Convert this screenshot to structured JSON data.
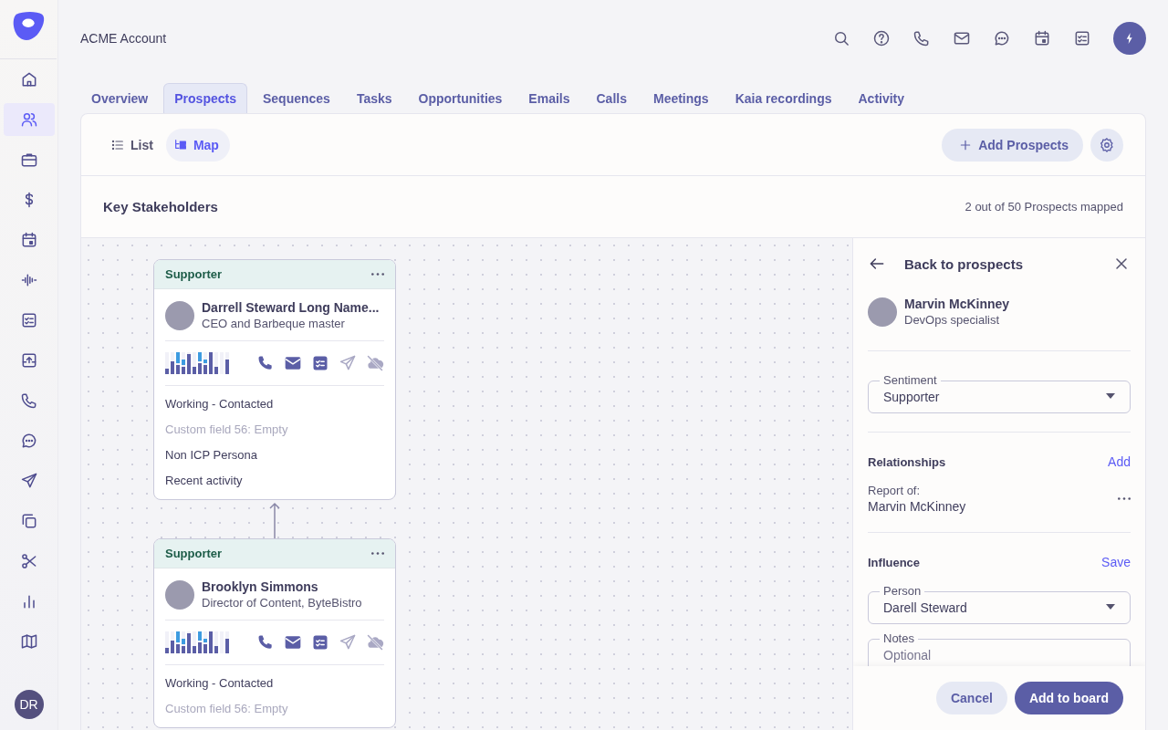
{
  "sidebar": {
    "items": [
      {
        "selected": false
      },
      {
        "selected": true
      },
      {
        "selected": false
      },
      {
        "selected": false
      },
      {
        "selected": false
      },
      {
        "selected": false
      },
      {
        "selected": false
      },
      {
        "selected": false
      },
      {
        "selected": false
      },
      {
        "selected": false
      },
      {
        "selected": false
      },
      {
        "selected": false
      },
      {
        "selected": false
      },
      {
        "selected": false
      },
      {
        "selected": false
      }
    ],
    "user_initials": "DR"
  },
  "header": {
    "title": "ACME Account"
  },
  "tabs": [
    {
      "label": "Overview",
      "selected": false
    },
    {
      "label": "Prospects",
      "selected": true
    },
    {
      "label": "Sequences",
      "selected": false
    },
    {
      "label": "Tasks",
      "selected": false
    },
    {
      "label": "Opportunities",
      "selected": false
    },
    {
      "label": "Emails",
      "selected": false
    },
    {
      "label": "Calls",
      "selected": false
    },
    {
      "label": "Meetings",
      "selected": false
    },
    {
      "label": "Kaia recordings",
      "selected": false
    },
    {
      "label": "Activity",
      "selected": false
    }
  ],
  "view_toggle": [
    {
      "kind": "list",
      "label": "List",
      "selected": false
    },
    {
      "kind": "map",
      "label": "Map",
      "selected": true
    }
  ],
  "add_button": "Add Prospects",
  "section": {
    "title": "Key Stakeholders",
    "summary": "2 out of 50 Prospects mapped"
  },
  "cards": [
    {
      "sentiment": "Supporter",
      "name": "Darrell Steward Long Name...",
      "role": "CEO and Barbeque master",
      "channels": [
        {
          "kind": "phone",
          "disabled": false
        },
        {
          "kind": "email",
          "disabled": false
        },
        {
          "kind": "task",
          "disabled": false
        },
        {
          "kind": "send",
          "disabled": true
        },
        {
          "kind": "cloud",
          "disabled": true
        }
      ],
      "fields": [
        {
          "text": "Working - Contacted",
          "empty": false
        },
        {
          "text": "Custom field 56: Empty",
          "empty": true
        },
        {
          "text": "Non ICP Persona",
          "empty": false
        },
        {
          "text": "Recent activity",
          "empty": false
        }
      ]
    },
    {
      "sentiment": "Supporter",
      "name": "Brooklyn Simmons",
      "role": "Director of Content, ByteBistro",
      "channels": [
        {
          "kind": "phone",
          "disabled": false
        },
        {
          "kind": "email",
          "disabled": false
        },
        {
          "kind": "task",
          "disabled": false
        },
        {
          "kind": "send",
          "disabled": true
        },
        {
          "kind": "cloud",
          "disabled": true
        }
      ],
      "fields": [
        {
          "text": "Working - Contacted",
          "empty": false
        },
        {
          "text": "Custom field 56: Empty",
          "empty": true
        }
      ]
    }
  ],
  "side_panel": {
    "back_label": "Back to prospects",
    "person": {
      "name": "Marvin McKinney",
      "role": "DevOps specialist"
    },
    "sentiment": {
      "label": "Sentiment",
      "value": "Supporter"
    },
    "relationships": {
      "title": "Relationships",
      "action": "Add",
      "items": [
        {
          "label": "Report of:",
          "name": "Marvin McKinney"
        }
      ]
    },
    "influence": {
      "title": "Influence",
      "action": "Save",
      "person": {
        "label": "Person",
        "value": "Darell Steward"
      },
      "notes": {
        "label": "Notes",
        "placeholder": "Optional"
      }
    },
    "buttons": [
      {
        "kind": "secondary",
        "label": "Cancel"
      },
      {
        "kind": "primary",
        "label": "Add to board"
      }
    ]
  }
}
